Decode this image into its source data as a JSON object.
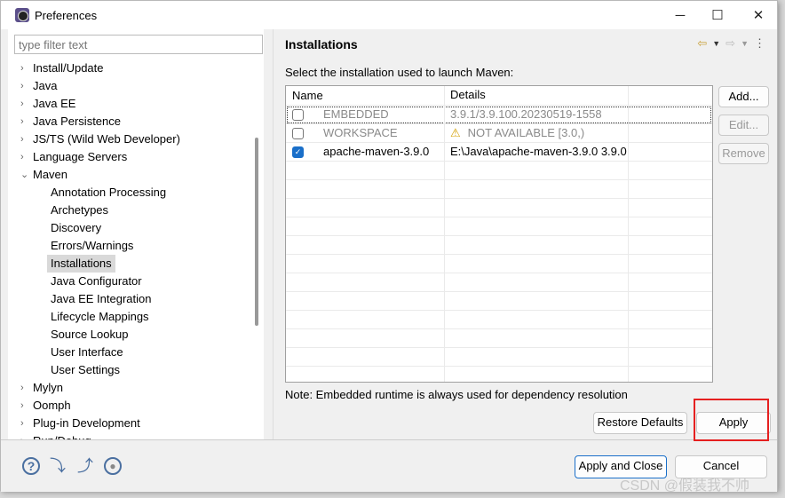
{
  "window": {
    "title": "Preferences",
    "minimize": "─",
    "maximize": "☐",
    "close": "✕"
  },
  "filter": {
    "placeholder": "type filter text"
  },
  "tree": [
    {
      "label": "Install/Update",
      "level": 0
    },
    {
      "label": "Java",
      "level": 0
    },
    {
      "label": "Java EE",
      "level": 0
    },
    {
      "label": "Java Persistence",
      "level": 0
    },
    {
      "label": "JS/TS (Wild Web Developer)",
      "level": 0
    },
    {
      "label": "Language Servers",
      "level": 0
    },
    {
      "label": "Maven",
      "level": 0,
      "expanded": true
    },
    {
      "label": "Annotation Processing",
      "level": 1
    },
    {
      "label": "Archetypes",
      "level": 1
    },
    {
      "label": "Discovery",
      "level": 1
    },
    {
      "label": "Errors/Warnings",
      "level": 1
    },
    {
      "label": "Installations",
      "level": 1,
      "selected": true
    },
    {
      "label": "Java Configurator",
      "level": 1
    },
    {
      "label": "Java EE Integration",
      "level": 1
    },
    {
      "label": "Lifecycle Mappings",
      "level": 1
    },
    {
      "label": "Source Lookup",
      "level": 1
    },
    {
      "label": "User Interface",
      "level": 1
    },
    {
      "label": "User Settings",
      "level": 1
    },
    {
      "label": "Mylyn",
      "level": 0
    },
    {
      "label": "Oomph",
      "level": 0
    },
    {
      "label": "Plug-in Development",
      "level": 0
    },
    {
      "label": "Run/Debug",
      "level": 0
    }
  ],
  "page": {
    "title": "Installations",
    "description": "Select the installation used to launch Maven:",
    "columns": [
      "Name",
      "Details"
    ],
    "rows": [
      {
        "checked": false,
        "name": "EMBEDDED",
        "details": "3.9.1/3.9.100.20230519-1558",
        "disabled": true
      },
      {
        "checked": false,
        "name": "WORKSPACE",
        "details": "NOT AVAILABLE [3.0,)",
        "disabled": true,
        "warning": true
      },
      {
        "checked": true,
        "name": "apache-maven-3.9.0",
        "details": "E:\\Java\\apache-maven-3.9.0 3.9.0",
        "disabled": false
      }
    ],
    "buttons": {
      "add": "Add...",
      "edit": "Edit...",
      "remove": "Remove"
    },
    "note": "Note: Embedded runtime is always used for dependency resolution",
    "restore_defaults": "Restore Defaults",
    "apply": "Apply"
  },
  "footer": {
    "apply_close": "Apply and Close",
    "cancel": "Cancel"
  },
  "watermark": "CSDN @假装我不帅",
  "colors": {
    "highlight_box": "#e52020",
    "checkbox_accent": "#1a6fc9"
  }
}
